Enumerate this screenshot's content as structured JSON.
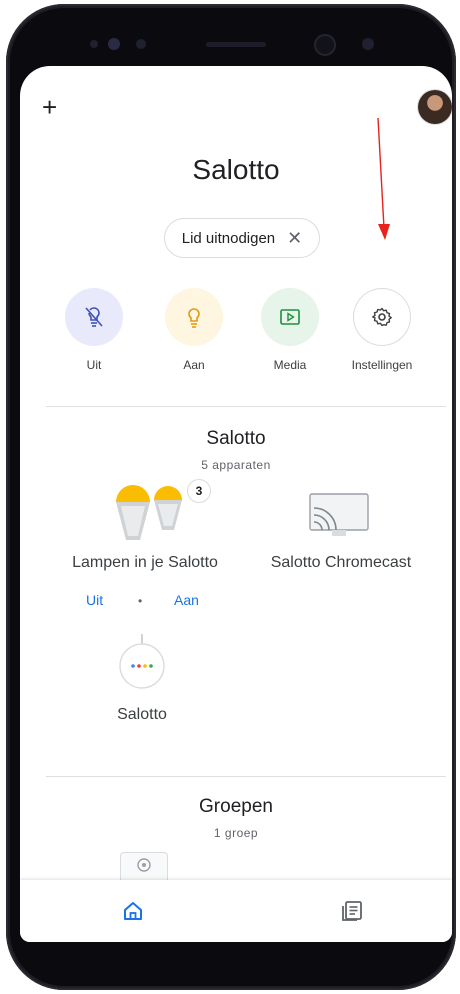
{
  "header": {
    "title": "Salotto",
    "add_icon": "plus-icon",
    "avatar_icon": "user-avatar"
  },
  "invite_chip": {
    "label": "Lid uitnodigen",
    "close_glyph": "✕"
  },
  "quick_actions": [
    {
      "label": "Uit",
      "icon": "light-off-icon",
      "bg": "#e8eafc",
      "fg": "#3f51b5"
    },
    {
      "label": "Aan",
      "icon": "light-on-icon",
      "bg": "#fef6e0",
      "fg": "#e49b0f"
    },
    {
      "label": "Media",
      "icon": "media-icon",
      "bg": "#e6f4ea",
      "fg": "#1e8e3e"
    },
    {
      "label": "Instellingen",
      "icon": "settings-icon",
      "bg": "#ffffff",
      "fg": "#3c4043"
    }
  ],
  "room": {
    "title": "Salotto",
    "subtitle": "5 apparaten",
    "lamp_group": {
      "label": "Lampen in je Salotto",
      "badge": "3",
      "off_label": "Uit",
      "separator": "•",
      "on_label": "Aan"
    },
    "chromecast": {
      "label": "Salotto Chromecast"
    },
    "speaker": {
      "label": "Salotto"
    }
  },
  "groups": {
    "title": "Groepen",
    "subtitle": "1 groep"
  },
  "bottom_nav": [
    {
      "name": "home",
      "icon": "home-icon",
      "active": true
    },
    {
      "name": "feed",
      "icon": "feed-icon",
      "active": false
    }
  ],
  "colors": {
    "accent": "#1a73e8",
    "annotation_arrow": "#e8221c"
  }
}
